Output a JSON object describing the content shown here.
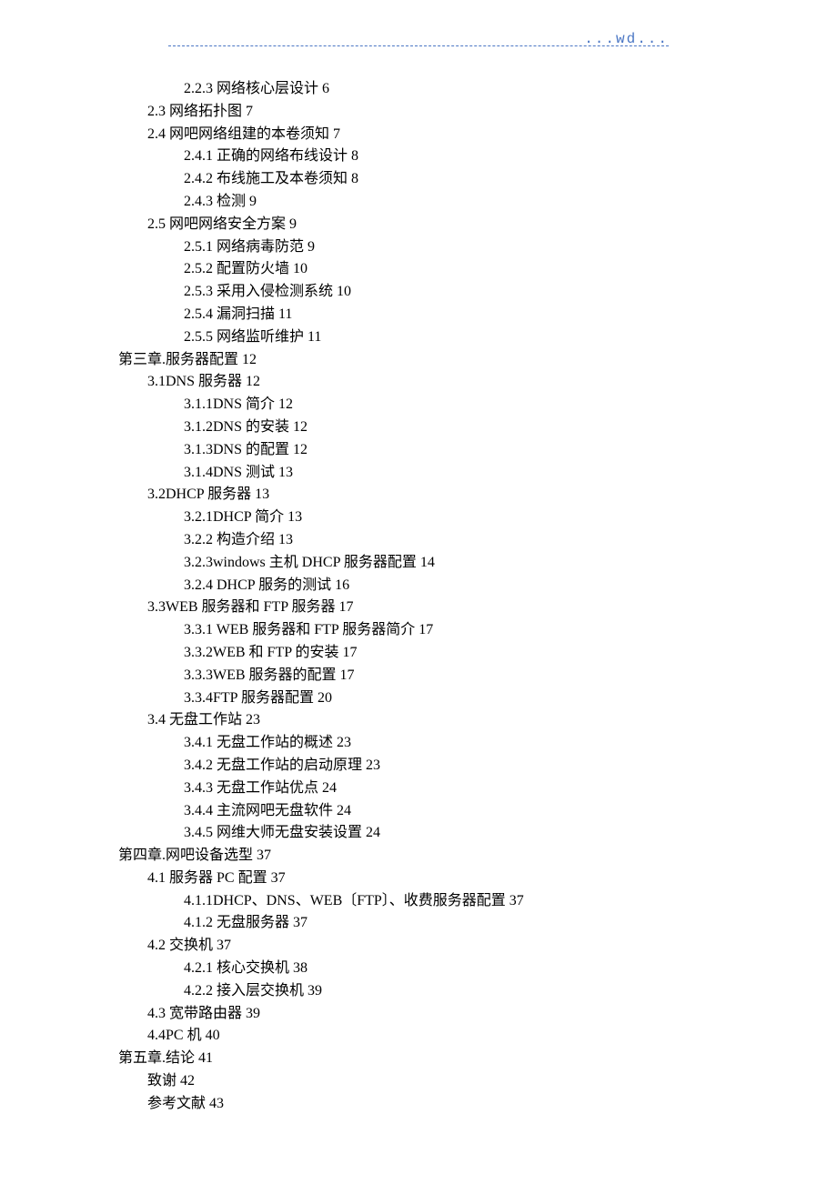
{
  "header": "...wd...",
  "toc": [
    {
      "level": 2,
      "text": "2.2.3 网络核心层设计 6"
    },
    {
      "level": 1,
      "text": "2.3 网络拓扑图 7"
    },
    {
      "level": 1,
      "text": "2.4 网吧网络组建的本卷须知 7"
    },
    {
      "level": 2,
      "text": "2.4.1 正确的网络布线设计 8"
    },
    {
      "level": 2,
      "text": "2.4.2 布线施工及本卷须知 8"
    },
    {
      "level": 2,
      "text": "2.4.3 检测 9"
    },
    {
      "level": 1,
      "text": "2.5 网吧网络安全方案 9"
    },
    {
      "level": 2,
      "text": "2.5.1 网络病毒防范 9"
    },
    {
      "level": 2,
      "text": "2.5.2 配置防火墙 10"
    },
    {
      "level": 2,
      "text": "2.5.3 采用入侵检测系统 10"
    },
    {
      "level": 2,
      "text": "2.5.4 漏洞扫描 11"
    },
    {
      "level": 2,
      "text": "2.5.5 网络监听维护 11"
    },
    {
      "level": 0,
      "text": "第三章.服务器配置 12"
    },
    {
      "level": 1,
      "text": "3.1DNS 服务器 12"
    },
    {
      "level": 2,
      "text": "3.1.1DNS 简介 12"
    },
    {
      "level": 2,
      "text": "3.1.2DNS 的安装 12"
    },
    {
      "level": 2,
      "text": "3.1.3DNS 的配置 12"
    },
    {
      "level": 2,
      "text": "3.1.4DNS 测试 13"
    },
    {
      "level": 1,
      "text": "3.2DHCP 服务器 13"
    },
    {
      "level": 2,
      "text": "3.2.1DHCP 简介 13"
    },
    {
      "level": 2,
      "text": "3.2.2 构造介绍 13"
    },
    {
      "level": 2,
      "text": "3.2.3windows 主机 DHCP 服务器配置 14"
    },
    {
      "level": 2,
      "text": "3.2.4 DHCP 服务的测试 16"
    },
    {
      "level": 1,
      "text": "3.3WEB 服务器和 FTP 服务器 17"
    },
    {
      "level": 2,
      "text": "3.3.1 WEB 服务器和 FTP 服务器简介 17"
    },
    {
      "level": 2,
      "text": "3.3.2WEB 和 FTP 的安装 17"
    },
    {
      "level": 2,
      "text": "3.3.3WEB 服务器的配置 17"
    },
    {
      "level": 2,
      "text": "3.3.4FTP 服务器配置 20"
    },
    {
      "level": 1,
      "text": "3.4 无盘工作站 23"
    },
    {
      "level": 2,
      "text": "3.4.1 无盘工作站的概述 23"
    },
    {
      "level": 2,
      "text": "3.4.2 无盘工作站的启动原理 23"
    },
    {
      "level": 2,
      "text": "3.4.3 无盘工作站优点 24"
    },
    {
      "level": 2,
      "text": "3.4.4 主流网吧无盘软件 24"
    },
    {
      "level": 2,
      "text": "3.4.5 网维大师无盘安装设置 24"
    },
    {
      "level": 0,
      "text": "第四章.网吧设备选型 37"
    },
    {
      "level": 1,
      "text": "4.1 服务器 PC 配置 37"
    },
    {
      "level": 2,
      "text": "4.1.1DHCP、DNS、WEB〔FTP〕、收费服务器配置 37"
    },
    {
      "level": 2,
      "text": "4.1.2 无盘服务器 37"
    },
    {
      "level": 1,
      "text": "4.2 交换机 37"
    },
    {
      "level": 2,
      "text": "4.2.1 核心交换机 38"
    },
    {
      "level": 2,
      "text": "4.2.2 接入层交换机 39"
    },
    {
      "level": 1,
      "text": "4.3 宽带路由器 39"
    },
    {
      "level": 1,
      "text": "4.4PC 机 40"
    },
    {
      "level": 0,
      "text": "第五章.结论 41"
    },
    {
      "level": 1,
      "text": "致谢 42"
    },
    {
      "level": 1,
      "text": "参考文献 43"
    }
  ]
}
